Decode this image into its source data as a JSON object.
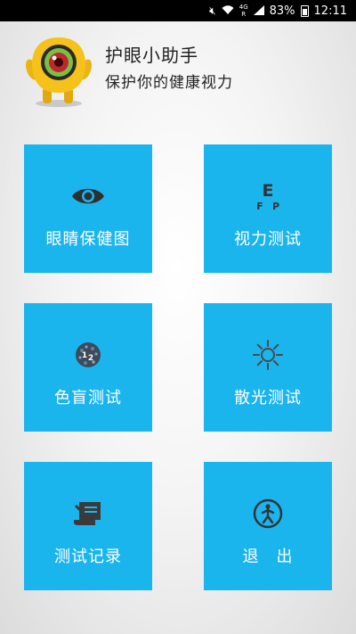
{
  "status_bar": {
    "network": "4G",
    "network_sub": "R",
    "battery": "83%",
    "time": "12:11"
  },
  "header": {
    "title": "护眼小助手",
    "subtitle": "保护你的健康视力"
  },
  "menu": [
    {
      "label": "眼睛保健图",
      "icon": "eye-icon"
    },
    {
      "label": "视力测试",
      "icon": "eye-chart-icon"
    },
    {
      "label": "色盲测试",
      "icon": "color-blind-plate-icon"
    },
    {
      "label": "散光测试",
      "icon": "astigmatism-dial-icon"
    },
    {
      "label": "测试记录",
      "icon": "record-scroll-icon"
    },
    {
      "label": "退　出",
      "icon": "exit-person-icon"
    }
  ],
  "colors": {
    "tile": "#1bb5ee",
    "icon": "#3a3a3a",
    "mascot_body": "#f4c21b"
  }
}
